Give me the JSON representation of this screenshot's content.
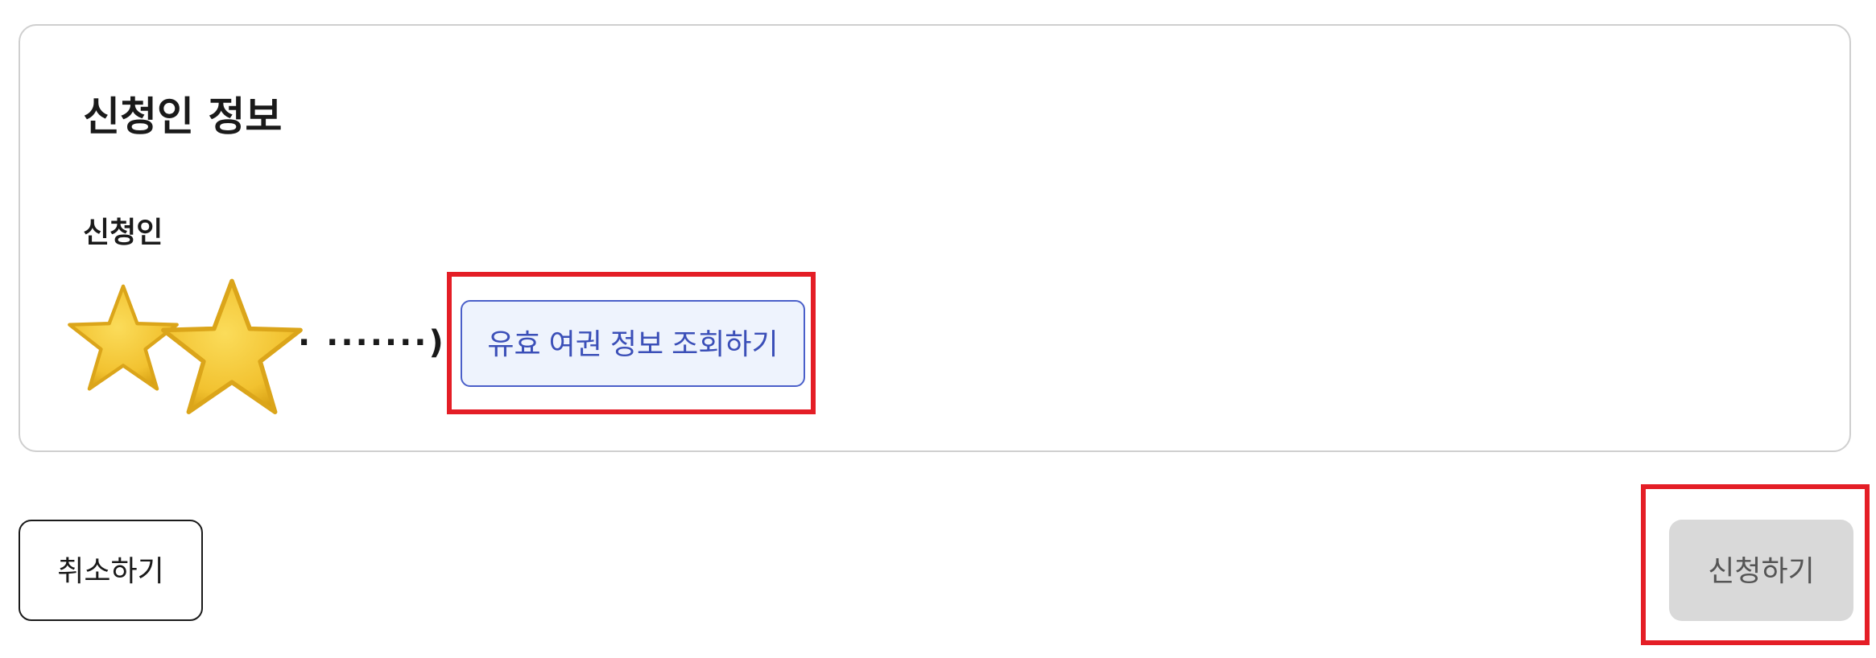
{
  "applicant_section": {
    "title": "신청인 정보",
    "field_label": "신청인",
    "masked_value": "· ·······)",
    "decoration": [
      "star-icon",
      "star-icon"
    ],
    "passport_lookup_button": "유효 여권 정보 조회하기"
  },
  "actions": {
    "cancel_label": "취소하기",
    "submit_label": "신청하기",
    "submit_disabled": true
  },
  "colors": {
    "highlight": "#e41e26",
    "lookup_button_bg": "#eef3fd",
    "lookup_button_border": "#4a5fc9",
    "lookup_button_text": "#3b4fb8",
    "disabled_button_bg": "#d9d9d9",
    "star": "#f2c230"
  }
}
